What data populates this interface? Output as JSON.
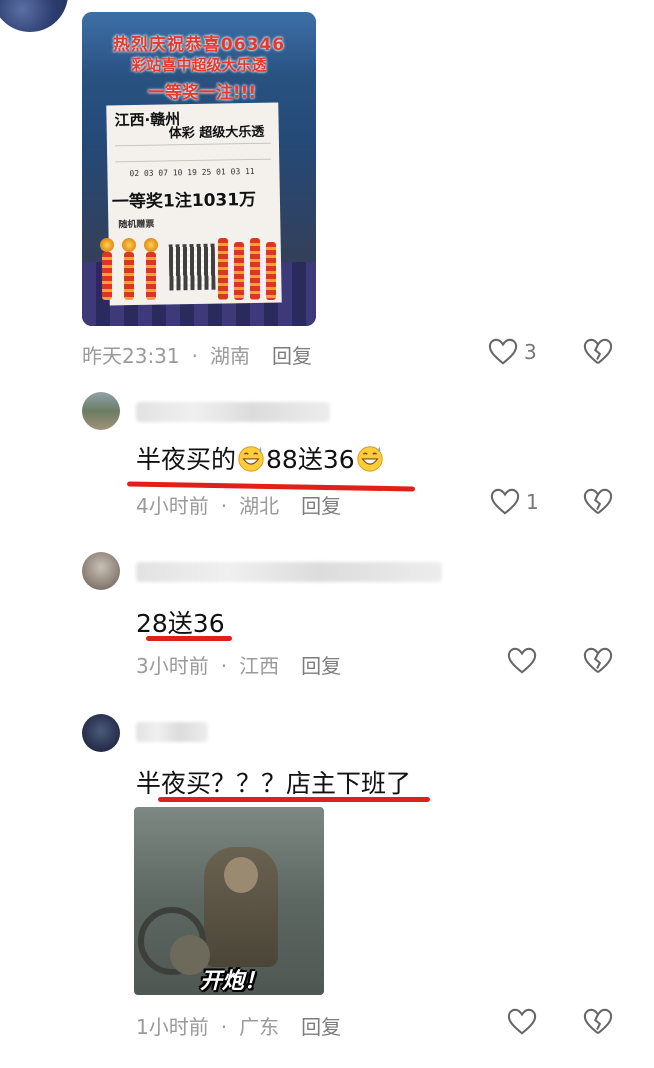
{
  "root_comment": {
    "photo": {
      "banner_line1": "热烈庆祝恭喜06346",
      "banner_line2": "彩站喜中超级大乐透",
      "banner_line3": "一等奖一注!!!",
      "ticket_title": "江西·赣州",
      "ticket_subtitle": "体彩 超级大乐透",
      "ticket_numbers": "02 03 07 10 19 25  01 03 11",
      "ticket_prize": "一等奖1注1031万",
      "ticket_random": "随机赠票"
    },
    "time": "昨天23:31",
    "location": "湖南",
    "reply_label": "回复",
    "like_count": "3"
  },
  "replies": [
    {
      "text_before": "半夜买的",
      "text_middle": "88送36",
      "time": "4小时前",
      "location": "湖北",
      "reply_label": "回复",
      "like_count": "1",
      "emoji": "grinning-sweat-emoji"
    },
    {
      "text": "28送36",
      "time": "3小时前",
      "location": "江西",
      "reply_label": "回复",
      "like_count": ""
    },
    {
      "text": "半夜买？？？店主下班了",
      "gif_caption": "开炮！",
      "time": "1小时前",
      "location": "广东",
      "reply_label": "回复",
      "like_count": ""
    }
  ],
  "icons": {
    "like": "heart-outline-icon",
    "dislike": "broken-heart-icon"
  },
  "colors": {
    "underline": "#e0201a",
    "meta_text": "#9a9a9a",
    "icon_stroke": "#666666"
  }
}
